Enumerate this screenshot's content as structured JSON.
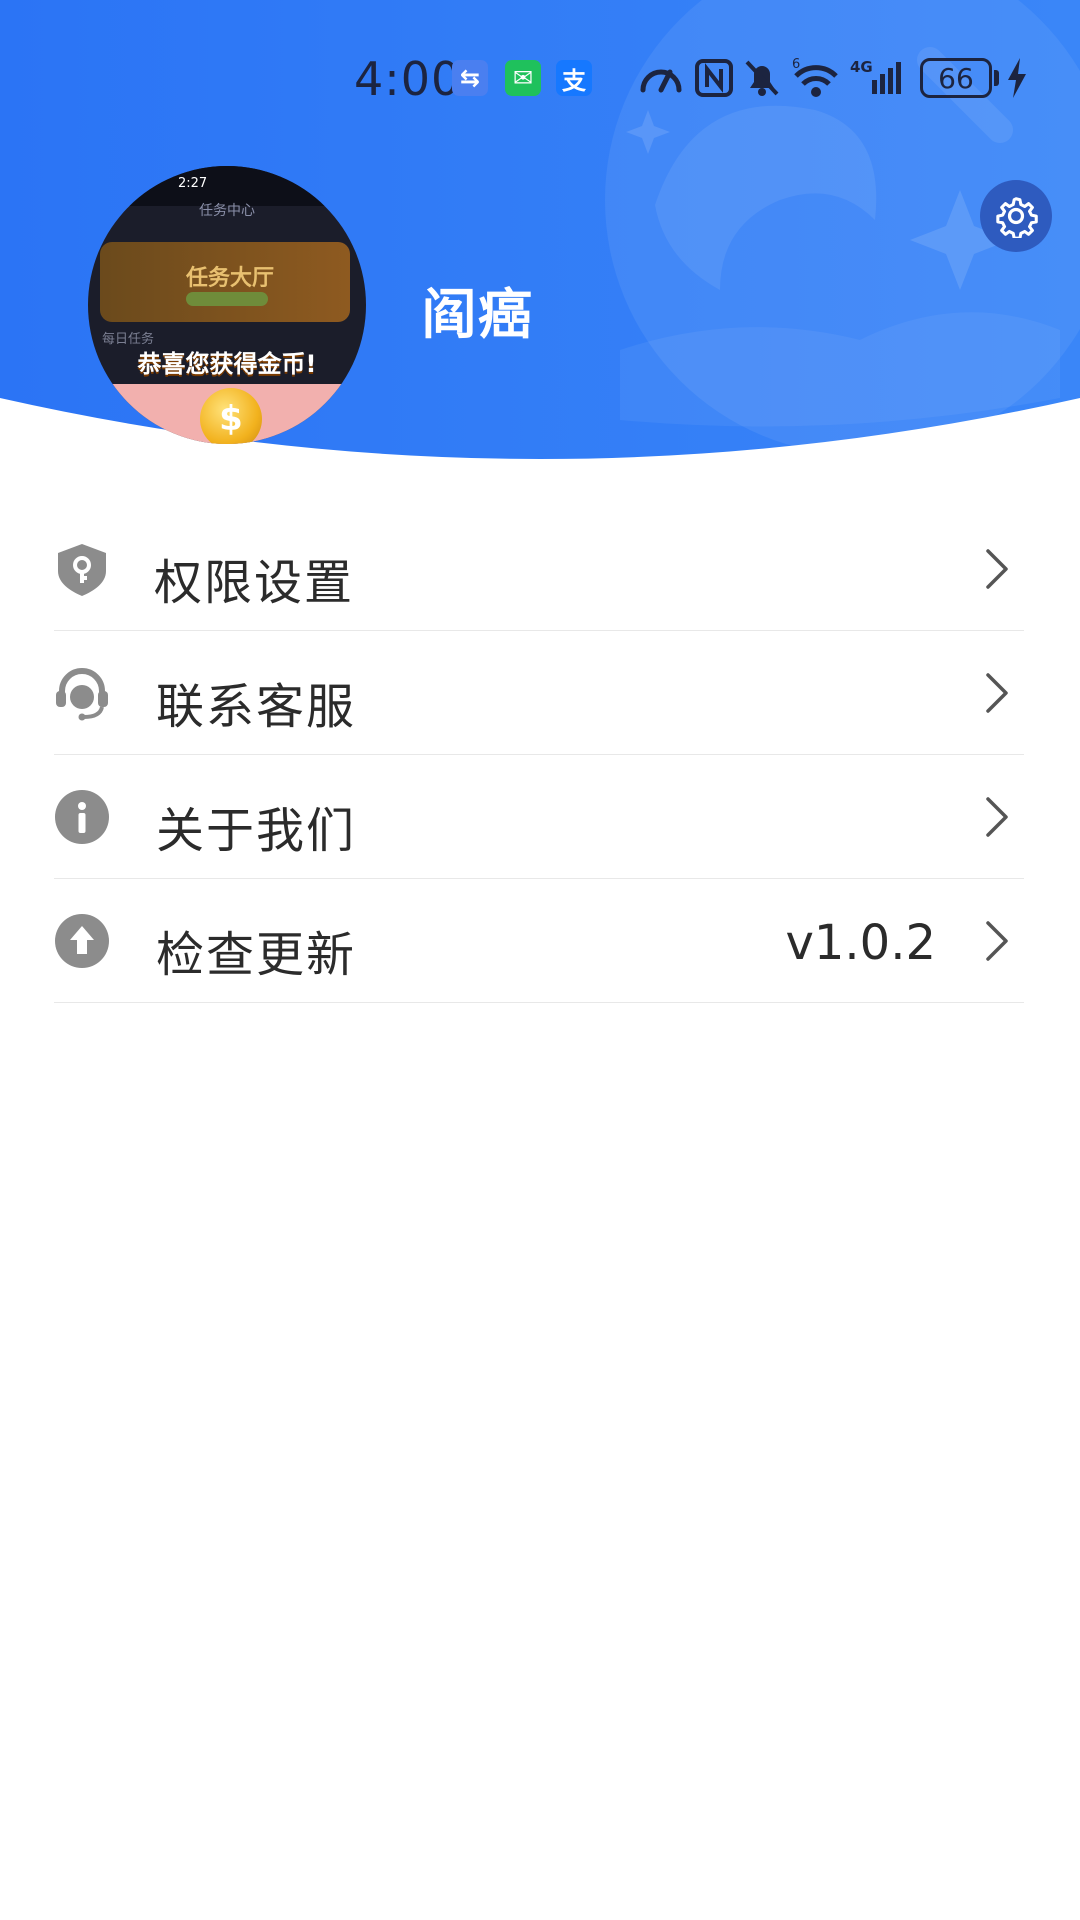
{
  "status_bar": {
    "time": "4:00",
    "app_icons": [
      {
        "name": "usb-icon",
        "color": "#4a7ff0",
        "glyph": "⇆"
      },
      {
        "name": "wechat-icon",
        "color": "#1fc15c",
        "glyph": "✉"
      },
      {
        "name": "alipay-icon",
        "color": "#1678ff",
        "glyph": "支"
      }
    ],
    "system_icons": [
      "speed-icon",
      "nfc-icon",
      "mute-bell-icon",
      "wifi-6-icon",
      "4g-signal-icon"
    ],
    "battery": "66",
    "charging": true
  },
  "profile": {
    "username": "阎癌",
    "avatar": {
      "time": "2:27",
      "title": "任务中心",
      "banner": "任务大厅",
      "daily": "每日任务",
      "congrats": "恭喜您获得金币!",
      "coin_symbol": "$"
    },
    "settings_icon": "gear-icon"
  },
  "menu": {
    "items": [
      {
        "icon": "shield-key-icon",
        "label": "权限设置",
        "value": ""
      },
      {
        "icon": "headset-icon",
        "label": "联系客服",
        "value": ""
      },
      {
        "icon": "info-icon",
        "label": "关于我们",
        "value": ""
      },
      {
        "icon": "upload-arrow-icon",
        "label": "检查更新",
        "value": "v1.0.2"
      }
    ]
  },
  "colors": {
    "header_blue": "#2f7cf6",
    "icon_gray": "#8c8c8c",
    "text": "#2b2b2b",
    "divider": "#e8e8e8"
  }
}
